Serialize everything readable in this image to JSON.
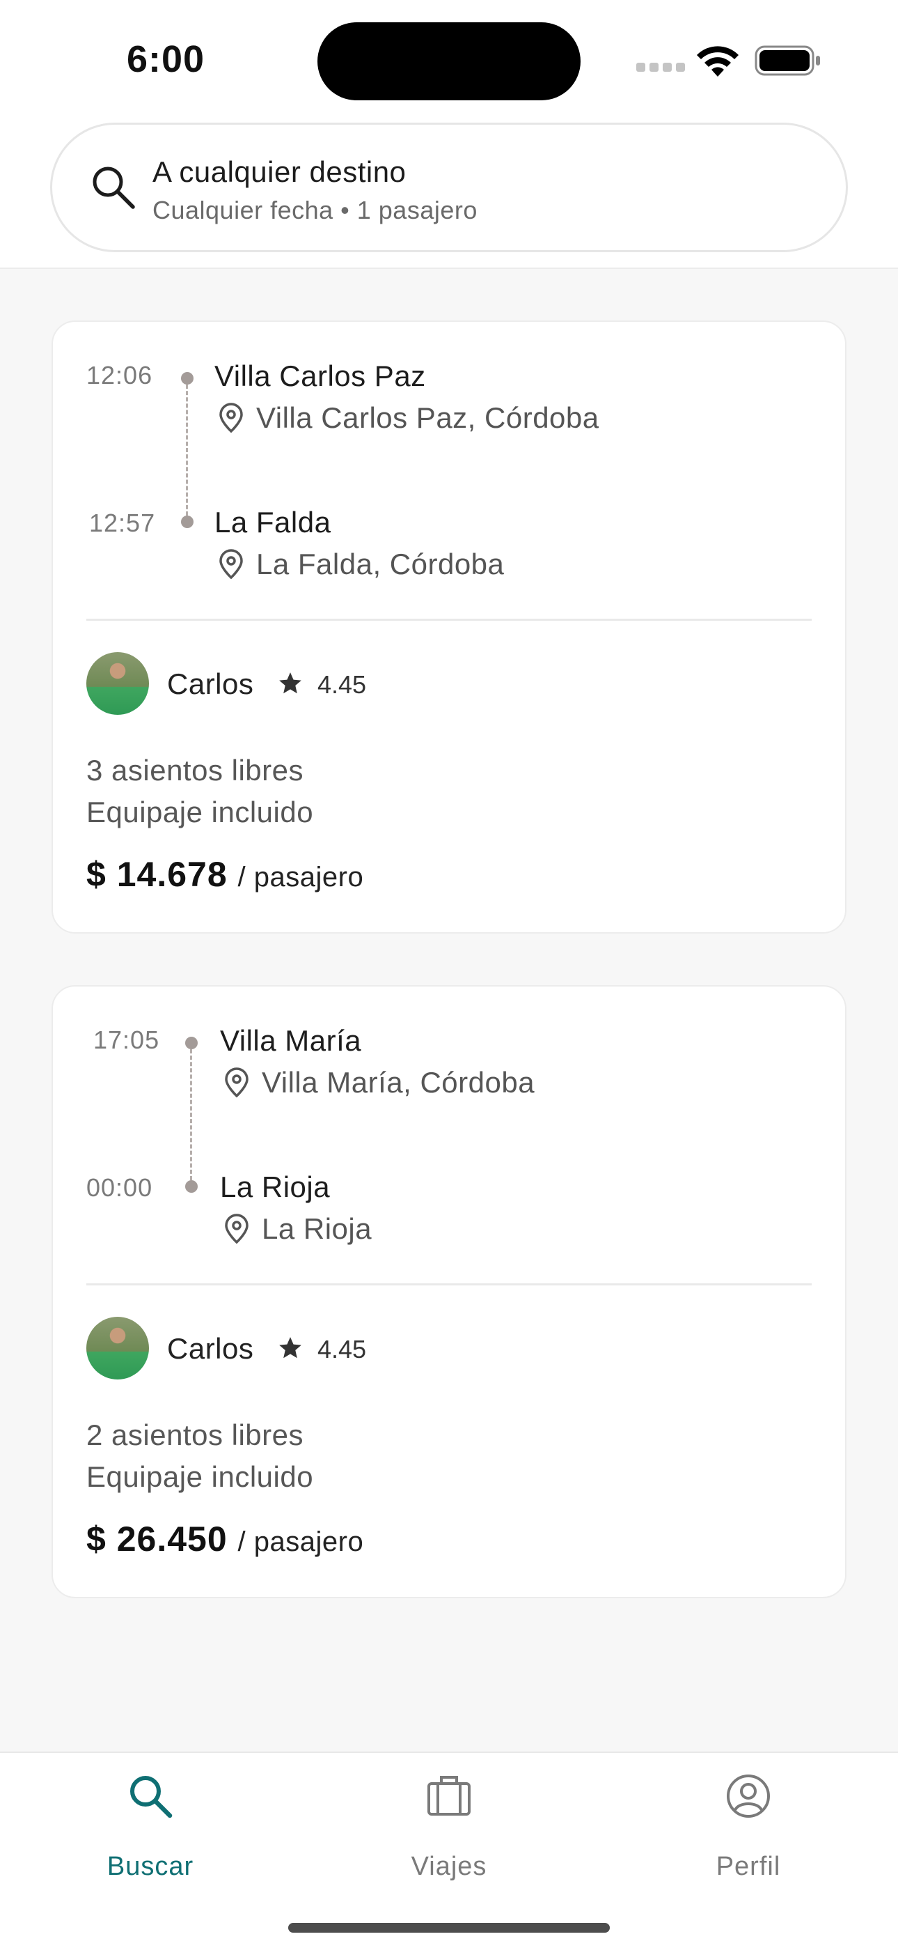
{
  "status_bar": {
    "time": "6:00"
  },
  "search": {
    "title": "A cualquier destino",
    "subtitle": "Cualquier fecha • 1 pasajero"
  },
  "trips": [
    {
      "departure_time": "12:06",
      "origin_name": "Villa Carlos Paz",
      "origin_address": "Villa Carlos Paz, Córdoba",
      "arrival_time": "12:57",
      "destination_name": "La Falda",
      "destination_address": "La Falda, Córdoba",
      "driver_name": "Carlos",
      "rating": "4.45",
      "seats": "3 asientos libres",
      "luggage": "Equipaje incluido",
      "price": "$ 14.678",
      "price_unit": "/ pasajero"
    },
    {
      "departure_time": "17:05",
      "origin_name": "Villa María",
      "origin_address": "Villa María, Córdoba",
      "arrival_time": "00:00",
      "destination_name": "La Rioja",
      "destination_address": "La Rioja",
      "driver_name": "Carlos",
      "rating": "4.45",
      "seats": "2 asientos libres",
      "luggage": "Equipaje incluido",
      "price": "$ 26.450",
      "price_unit": "/ pasajero"
    }
  ],
  "tabs": [
    {
      "label": "Buscar",
      "icon": "search-icon",
      "active": true
    },
    {
      "label": "Viajes",
      "icon": "briefcase-icon",
      "active": false
    },
    {
      "label": "Perfil",
      "icon": "profile-icon",
      "active": false
    }
  ],
  "colors": {
    "accent": "#0f6f73",
    "inactive": "#7a7a7a",
    "route_dot": "#a39b98"
  }
}
